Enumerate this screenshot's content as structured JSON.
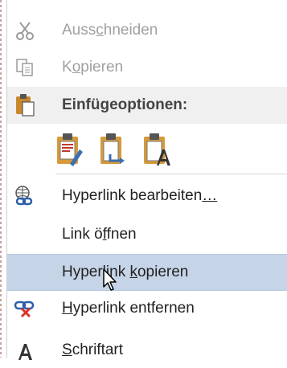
{
  "menu": {
    "cut": {
      "pre": "Auss",
      "accel": "c",
      "post": "hneiden",
      "icon": "scissors-icon"
    },
    "copy": {
      "pre": "K",
      "accel": "o",
      "post": "pieren",
      "icon": "copy-icon"
    },
    "paste_options": {
      "label": "Einfügeoptionen:",
      "icon": "clipboard-icon"
    },
    "paste_buttons": [
      "keep-source-formatting-icon",
      "merge-formatting-icon",
      "keep-text-only-icon"
    ],
    "edit_hyperlink": {
      "pre": "Hyperlink bearbeiten",
      "accel": "…",
      "post": "",
      "icon": "hyperlink-icon"
    },
    "open_link": {
      "pre": "Link ö",
      "accel": "f",
      "post": "fnen"
    },
    "copy_hyperlink": {
      "pre": "Hyperlink ",
      "accel": "k",
      "post": "opieren"
    },
    "remove_hyperlink": {
      "pre": "",
      "accel": "H",
      "post": "yperlink entfernen",
      "icon": "remove-hyperlink-icon"
    },
    "font": {
      "pre": "",
      "accel": "S",
      "post": "chriftart",
      "icon": "font-icon"
    }
  },
  "colors": {
    "highlight": "#c6d4e8",
    "header_bg": "#f0f0f0",
    "disabled_text": "#a0a0a0"
  }
}
